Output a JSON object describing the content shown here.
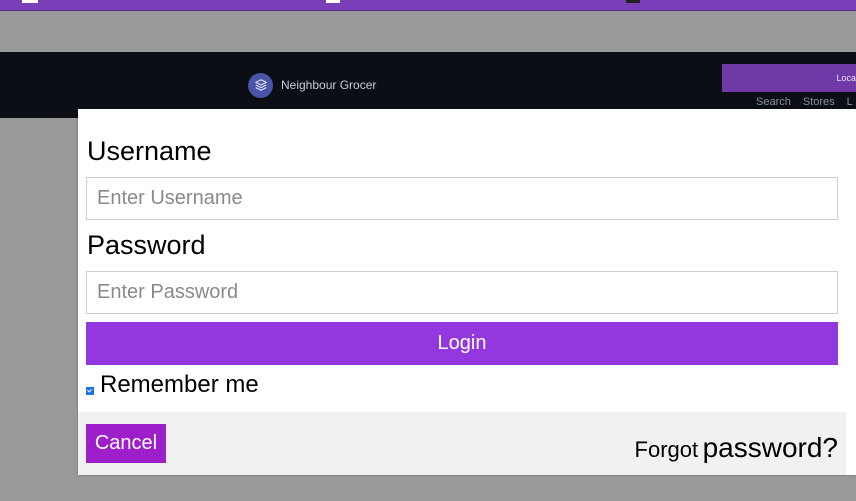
{
  "site": {
    "brand_name": "Neighbour Grocer",
    "locate_label": "Loca",
    "nav": [
      "Search",
      "Stores",
      "L"
    ]
  },
  "login_modal": {
    "username_label": "Username",
    "username_placeholder": "Enter Username",
    "password_label": "Password",
    "password_placeholder": "Enter Password",
    "login_label": "Login",
    "remember_label": "Remember me",
    "remember_checked": true,
    "cancel_label": "Cancel",
    "forgot_word1": "Forgot",
    "forgot_word2": "password?"
  },
  "colors": {
    "accent": "#9338df",
    "cancel": "#9c1fc9",
    "header_bg": "#0b0e14",
    "overlay": "#999999"
  },
  "icons": {
    "brand": "layers-icon"
  }
}
